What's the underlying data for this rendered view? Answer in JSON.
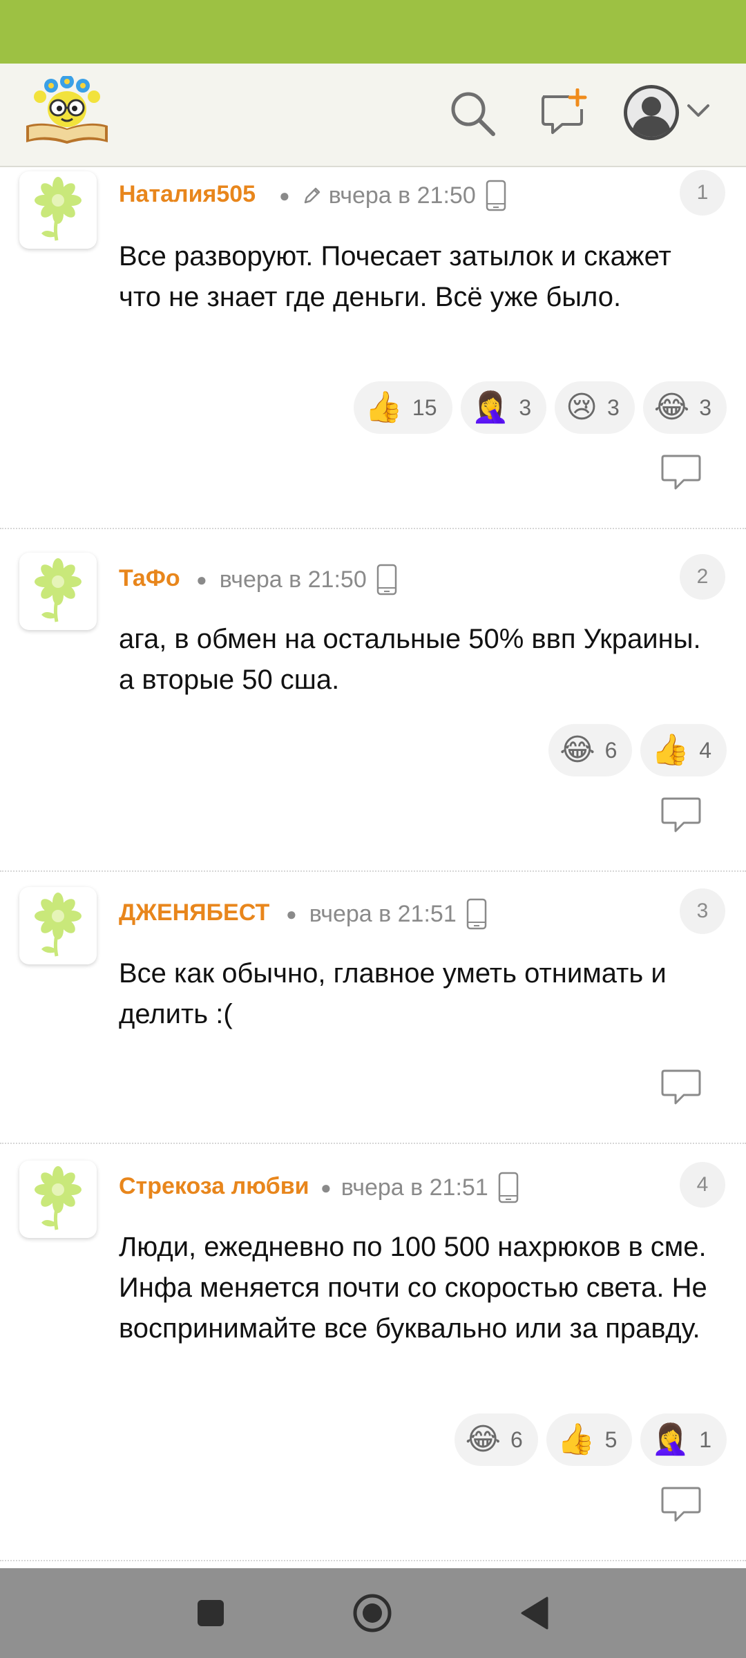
{
  "comments": [
    {
      "author": "Наталия505",
      "edited": true,
      "time": "вчера в 21:50",
      "number": "1",
      "text": "Все разворуют. Почесает затылок и скажет что не знает где деньги. Всё уже было.",
      "reactions": [
        {
          "emoji": "👍",
          "count": "15"
        },
        {
          "emoji": "🤦‍♀️",
          "count": "3"
        },
        {
          "emoji": "😢",
          "count": "3"
        },
        {
          "emoji": "😂",
          "count": "3"
        }
      ]
    },
    {
      "author": "ТаФо",
      "edited": false,
      "time": "вчера в 21:50",
      "number": "2",
      "text": "ага, в обмен на остальные 50% ввп Украины. а вторые 50 сша.",
      "reactions": [
        {
          "emoji": "😂",
          "count": "6"
        },
        {
          "emoji": "👍",
          "count": "4"
        }
      ]
    },
    {
      "author": "ДЖЕНЯБЕСТ",
      "edited": false,
      "time": "вчера в 21:51",
      "number": "3",
      "text": "Все как обычно, главное уметь отнимать и делить :(",
      "reactions": []
    },
    {
      "author": "Стрекоза любви",
      "edited": false,
      "time": "вчера в 21:51",
      "number": "4",
      "text": "Люди, ежедневно по 100 500 нахрюков в сме. Инфа меняется почти со скоростью света. Не воспринимайте все буквально или за правду.",
      "reactions": [
        {
          "emoji": "😂",
          "count": "6"
        },
        {
          "emoji": "👍",
          "count": "5"
        },
        {
          "emoji": "🤦‍♀️",
          "count": "1"
        }
      ]
    }
  ],
  "icons": {
    "search": "search-icon",
    "new_post": "new-post-icon",
    "avatar": "user-avatar-icon",
    "dropdown": "chevron-down-icon",
    "reply": "reply-icon",
    "nav_recent": "square-icon",
    "nav_home": "circle-icon",
    "nav_back": "back-triangle-icon"
  },
  "colors": {
    "status_bar": "#9dc143",
    "author": "#e8861c"
  }
}
